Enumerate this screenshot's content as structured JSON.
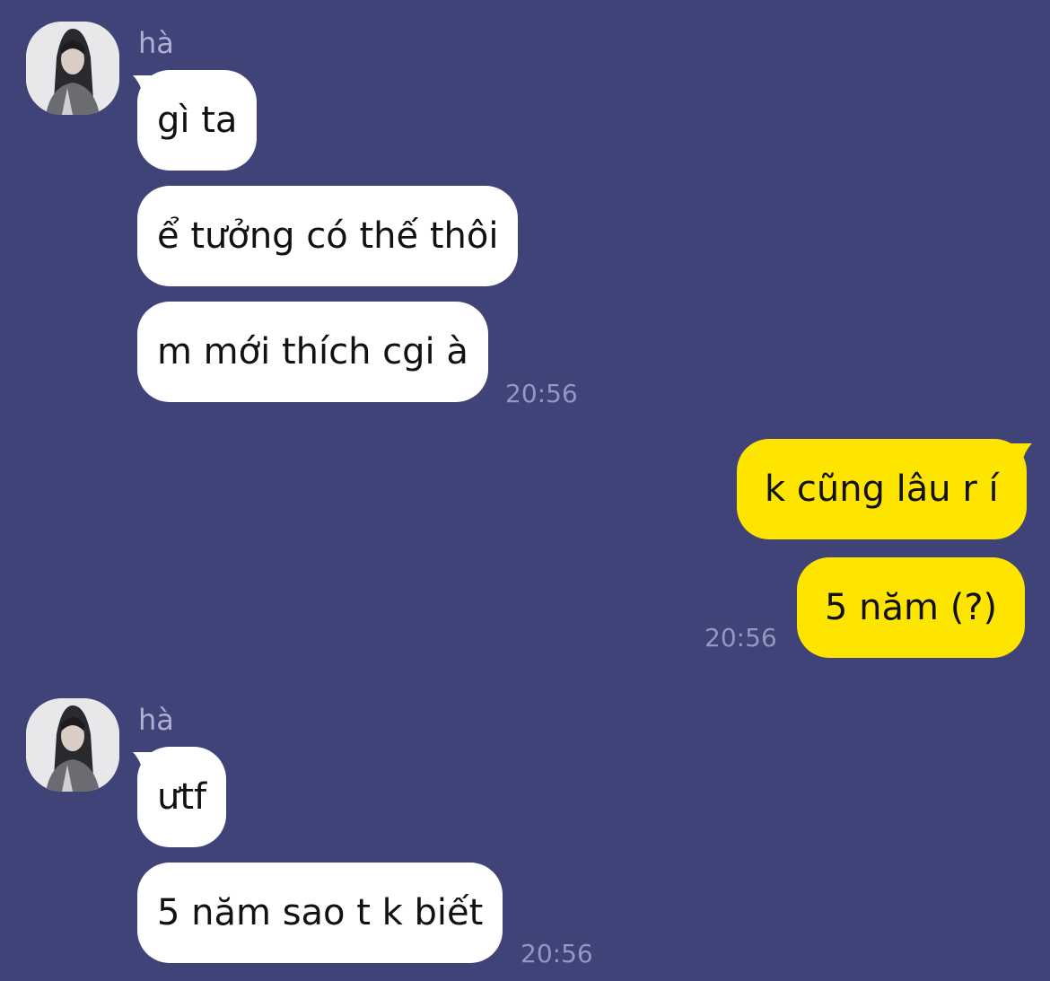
{
  "colors": {
    "background": "#404377",
    "incoming_bubble": "#ffffff",
    "outgoing_bubble": "#fee500",
    "sender_name": "#aeb0cf",
    "timestamp": "#9497be"
  },
  "groups": [
    {
      "sender": "hà",
      "avatar": "profile-photo",
      "messages": [
        "gì ta",
        "ể tưởng có thế thôi",
        "m mới thích cgi à"
      ],
      "time": "20:56"
    },
    {
      "sender": "me",
      "messages": [
        "k cũng lâu r í",
        "5 năm (?)"
      ],
      "time": "20:56"
    },
    {
      "sender": "hà",
      "avatar": "profile-photo",
      "messages": [
        "ưtf",
        "5 năm sao t k biết"
      ],
      "time": "20:56"
    }
  ]
}
